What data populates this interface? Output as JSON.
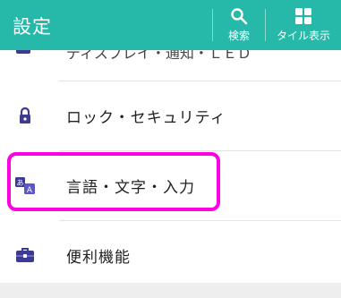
{
  "appbar": {
    "title": "設定",
    "actions": [
      {
        "label": "検索",
        "icon": "search-icon"
      },
      {
        "label": "タイル表示",
        "icon": "grid-icon"
      }
    ],
    "color": "#26b8a8"
  },
  "clipped_item": {
    "label": "ディスプレイ・通知・ＬＥＤ"
  },
  "list": {
    "items": [
      {
        "label": "ロック・セキュリティ",
        "icon": "lock-icon"
      },
      {
        "label": "言語・文字・入力",
        "icon": "language-icon"
      },
      {
        "label": "便利機能",
        "icon": "toolbox-icon"
      }
    ]
  },
  "accent": {
    "highlight": "#ff00e1",
    "icon": "#3d3a91"
  }
}
